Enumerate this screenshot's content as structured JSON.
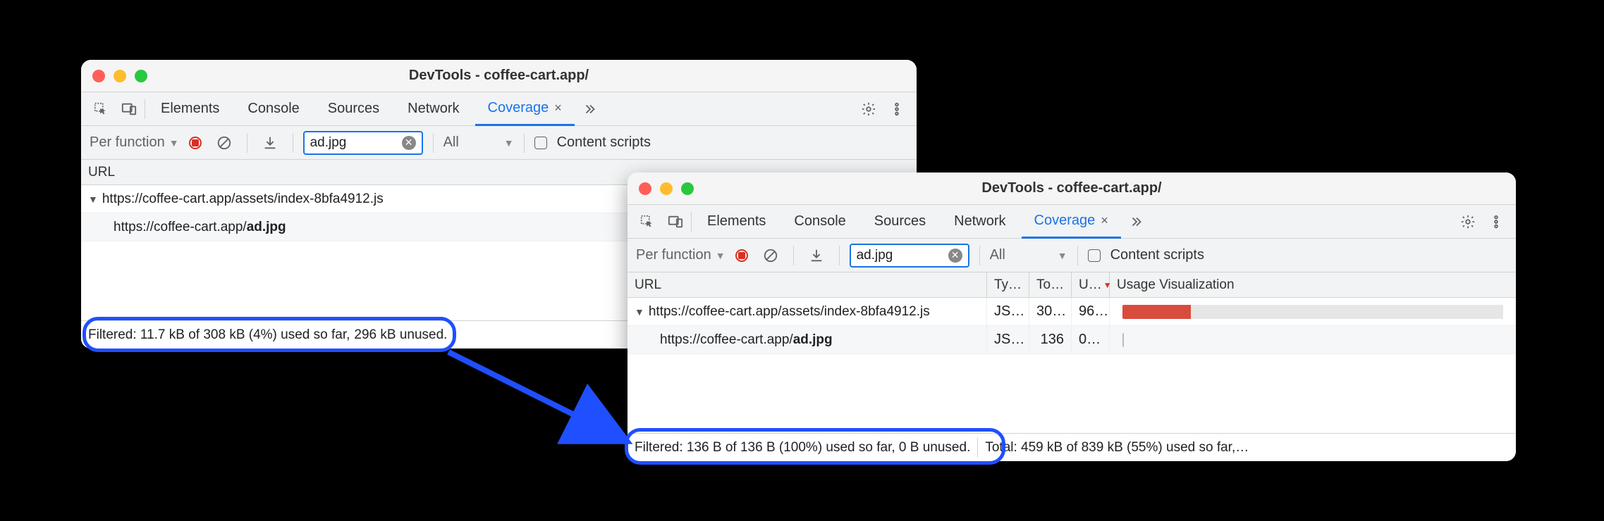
{
  "windows": {
    "left": {
      "title": "DevTools - coffee-cart.app/",
      "tabs": [
        "Elements",
        "Console",
        "Sources",
        "Network",
        "Coverage"
      ],
      "active_tab": "Coverage",
      "toolbar": {
        "granularity": "Per function",
        "filter_value": "ad.jpg",
        "type_filter": "All",
        "content_scripts_label": "Content scripts"
      },
      "columns": {
        "url": "URL"
      },
      "rows": [
        {
          "url_prefix": "https://coffee-cart.app/assets/index-8bfa4912.js",
          "url_bold": "",
          "has_twisty": true,
          "indent": 0
        },
        {
          "url_prefix": "https://coffee-cart.app/",
          "url_bold": "ad.jpg",
          "has_twisty": false,
          "indent": 1
        }
      ],
      "status": {
        "filtered": "Filtered: 11.7 kB of 308 kB (4%) used so far,",
        "tail": "296 kB unused."
      }
    },
    "right": {
      "title": "DevTools - coffee-cart.app/",
      "tabs": [
        "Elements",
        "Console",
        "Sources",
        "Network",
        "Coverage"
      ],
      "active_tab": "Coverage",
      "toolbar": {
        "granularity": "Per function",
        "filter_value": "ad.jpg",
        "type_filter": "All",
        "content_scripts_label": "Content scripts"
      },
      "columns": {
        "url": "URL",
        "type": "Ty…",
        "total": "To…",
        "unused": "U…",
        "usage": "Usage Visualization"
      },
      "rows": [
        {
          "url_prefix": "https://coffee-cart.app/assets/index-8bfa4912.js",
          "url_bold": "",
          "has_twisty": true,
          "indent": 0,
          "type": "JS…",
          "total": "30…",
          "unused": "96…",
          "usage_pct": 18
        },
        {
          "url_prefix": "https://coffee-cart.app/",
          "url_bold": "ad.jpg",
          "has_twisty": false,
          "indent": 1,
          "type": "JS…",
          "total": "136",
          "unused": "0…",
          "usage_pct": 1
        }
      ],
      "status": {
        "filtered": "Filtered: 136 B of 136 B (100%) used so far, 0 B unused.",
        "total": "Total: 459 kB of 839 kB (55%) used so far,…"
      }
    }
  }
}
